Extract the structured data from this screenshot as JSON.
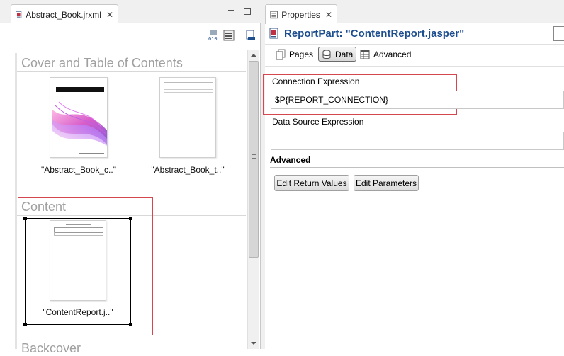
{
  "left_tab": {
    "title": "Abstract_Book.jrxml",
    "close": "✕"
  },
  "right_tab": {
    "title": "Properties",
    "close": "✕"
  },
  "sections": {
    "cover": "Cover and Table of Contents",
    "content": "Content",
    "backcover": "Backcover"
  },
  "thumbs": {
    "cover_caption": "\"Abstract_Book_c..\"",
    "toc_caption": "\"Abstract_Book_t..\"",
    "content_caption": "\"ContentReport.j..\""
  },
  "properties": {
    "header": "ReportPart: \"ContentReport.jasper\"",
    "tabs": [
      "Pages",
      "Data",
      "Advanced"
    ],
    "connection_label": "Connection Expression",
    "connection_value": "$P{REPORT_CONNECTION}",
    "datasource_label": "Data Source Expression",
    "datasource_value": "",
    "advanced_label": "Advanced",
    "btn_return": "Edit Return Values",
    "btn_params": "Edit Parameters"
  },
  "colors": {
    "accent": "#1d4e8f",
    "highlight": "#d6464e"
  }
}
